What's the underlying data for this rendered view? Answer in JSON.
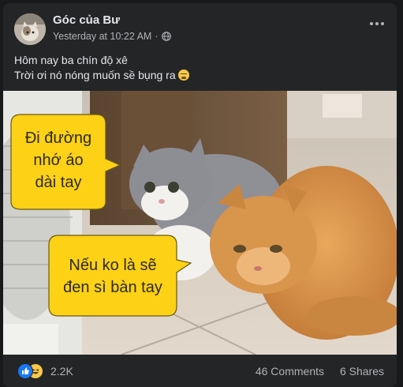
{
  "post": {
    "author": "Góc của Bư",
    "timestamp": "Yesterday at 10:22 AM",
    "separator": "·",
    "privacy_icon": "globe-icon",
    "more_icon": "more-horizontal-icon",
    "caption_lines": [
      "Hôm nay ba chín độ xê",
      "Trời ơi nó nóng muốn sề bụng ra"
    ],
    "caption_emoji": "tired-face-emoji"
  },
  "image": {
    "bubble_top_lines": [
      "Đi đường",
      "nhớ áo",
      "dài tay"
    ],
    "bubble_bottom_lines": [
      "Nếu ko là sẽ",
      "đen sì bàn tay"
    ],
    "bubble_color": "#fcd116"
  },
  "footer": {
    "reaction_icons": [
      "like-icon",
      "haha-icon"
    ],
    "reaction_count": "2.2K",
    "comments": "46 Comments",
    "shares": "6 Shares"
  }
}
